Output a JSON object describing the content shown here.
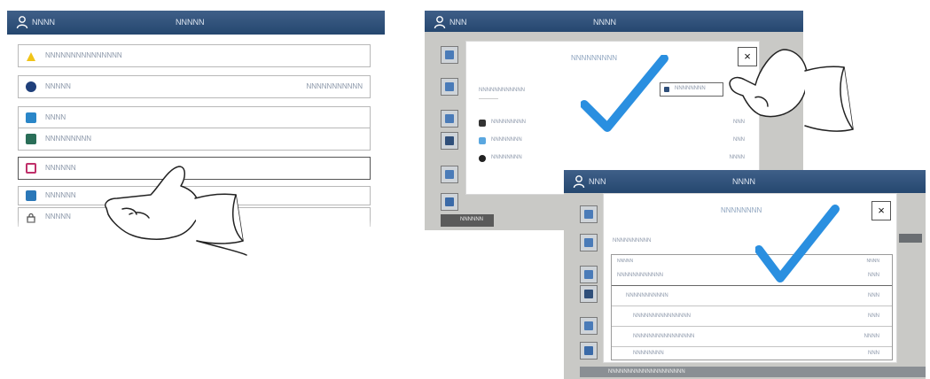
{
  "panel1": {
    "header": {
      "user_icon": "person-icon",
      "user_name": "NNNN",
      "title": "NNNNN"
    },
    "rows": [
      {
        "icon": "warning-icon",
        "color": "#f0c418",
        "label": "NNNNNNNNNNNNNNN",
        "value": ""
      },
      {
        "icon": "info-icon",
        "color": "#1f3f7a",
        "label": "NNNNN",
        "value": "NNNNNNNNNNN"
      },
      {
        "icon": "pause-icon",
        "color": "#2a86c8",
        "label": "NNNN",
        "value": ""
      },
      {
        "icon": "network-icon",
        "color": "#2a6e58",
        "label": "NNNNNNNNN",
        "value": ""
      },
      {
        "icon": "square-icon",
        "color": "#c0306a",
        "label": "NNNNNN",
        "value": ""
      },
      {
        "icon": "tablet-icon",
        "color": "#2a77b8",
        "label": "NNNNNN",
        "value": ""
      },
      {
        "icon": "lock-icon",
        "color": "#555555",
        "label": "NNNNN",
        "value": ""
      }
    ]
  },
  "panel2": {
    "header": {
      "user_icon": "person-icon",
      "user_name": "NNN",
      "title": "NNNN"
    },
    "dialog": {
      "title": "NNNNNNNNN",
      "close_label": "×",
      "subtitle": "NNNNNNNNNNNN",
      "action_label": "NNNNNNNN",
      "devices": [
        {
          "icon_color": "#333333",
          "name": "NNNNNNNNN",
          "status": "NNN"
        },
        {
          "icon_color": "#5aa7e0",
          "name": "NNNNNNNN",
          "status": "NNN"
        },
        {
          "icon_color": "#222222",
          "name": "NNNNNNNN",
          "status": "NNNN"
        }
      ]
    },
    "footer_label": "NNNNNN"
  },
  "panel3": {
    "header": {
      "user_icon": "person-icon",
      "user_name": "NNN",
      "title": "NNNN"
    },
    "dialog": {
      "title": "NNNNNNNN",
      "close_label": "×",
      "subtitle": "NNNNNNNNNN",
      "table": {
        "headers": [
          "NNNNN",
          "NNNN"
        ],
        "rows": [
          {
            "name": "NNNNNNNNNNNN",
            "value": "NNN"
          },
          {
            "name": "NNNNNNNNNNN",
            "value": "NNN"
          },
          {
            "name": "NNNNNNNNNNNNNNN",
            "value": "NNN"
          },
          {
            "name": "NNNNNNNNNNNNNNNN",
            "value": "NNNN"
          },
          {
            "name": "NNNNNNNN",
            "value": "NNN"
          }
        ]
      }
    },
    "footer_label": "NNNNNNNNNNNNNNNNNNNN"
  },
  "colors": {
    "header_blue": "#2f5079",
    "check_blue": "#2a8fe0",
    "tile_blue": "#4a7bb8"
  }
}
